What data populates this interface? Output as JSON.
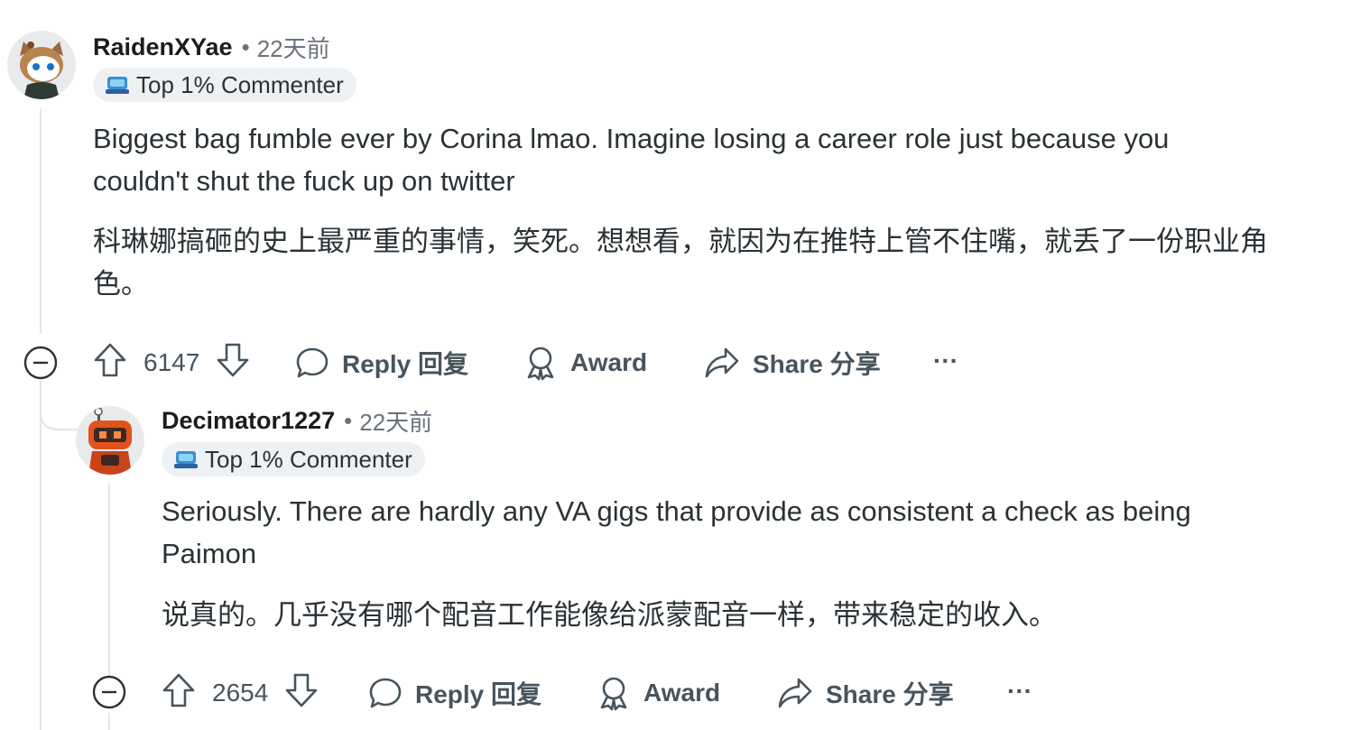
{
  "comments": [
    {
      "username": "RaidenXYae",
      "separator": "•",
      "time": "22天前",
      "badge": "Top 1% Commenter",
      "text_en": "Biggest bag fumble ever by Corina lmao. Imagine losing a career role just because you couldn't shut the fuck up on twitter",
      "text_zh": "科琳娜搞砸的史上最严重的事情，笑死。想想看，就因为在推特上管不住嘴，就丢了一份职业角色。",
      "votes": "6147",
      "reply_label": "Reply 回复",
      "award_label": "Award",
      "share_label": "Share 分享",
      "more": "···"
    },
    {
      "username": "Decimator1227",
      "separator": "•",
      "time": "22天前",
      "badge": "Top 1% Commenter",
      "text_en": "Seriously. There are hardly any VA gigs that provide as consistent a check as being Paimon",
      "text_zh": "说真的。几乎没有哪个配音工作能像给派蒙配音一样，带来稳定的收入。",
      "votes": "2654",
      "reply_label": "Reply 回复",
      "award_label": "Award",
      "share_label": "Share 分享",
      "more": "···"
    }
  ],
  "colors": {
    "text": "#2a3236",
    "meta": "#6a737c",
    "badge_bg": "#eef1f3",
    "thread": "#e3e6e8"
  }
}
